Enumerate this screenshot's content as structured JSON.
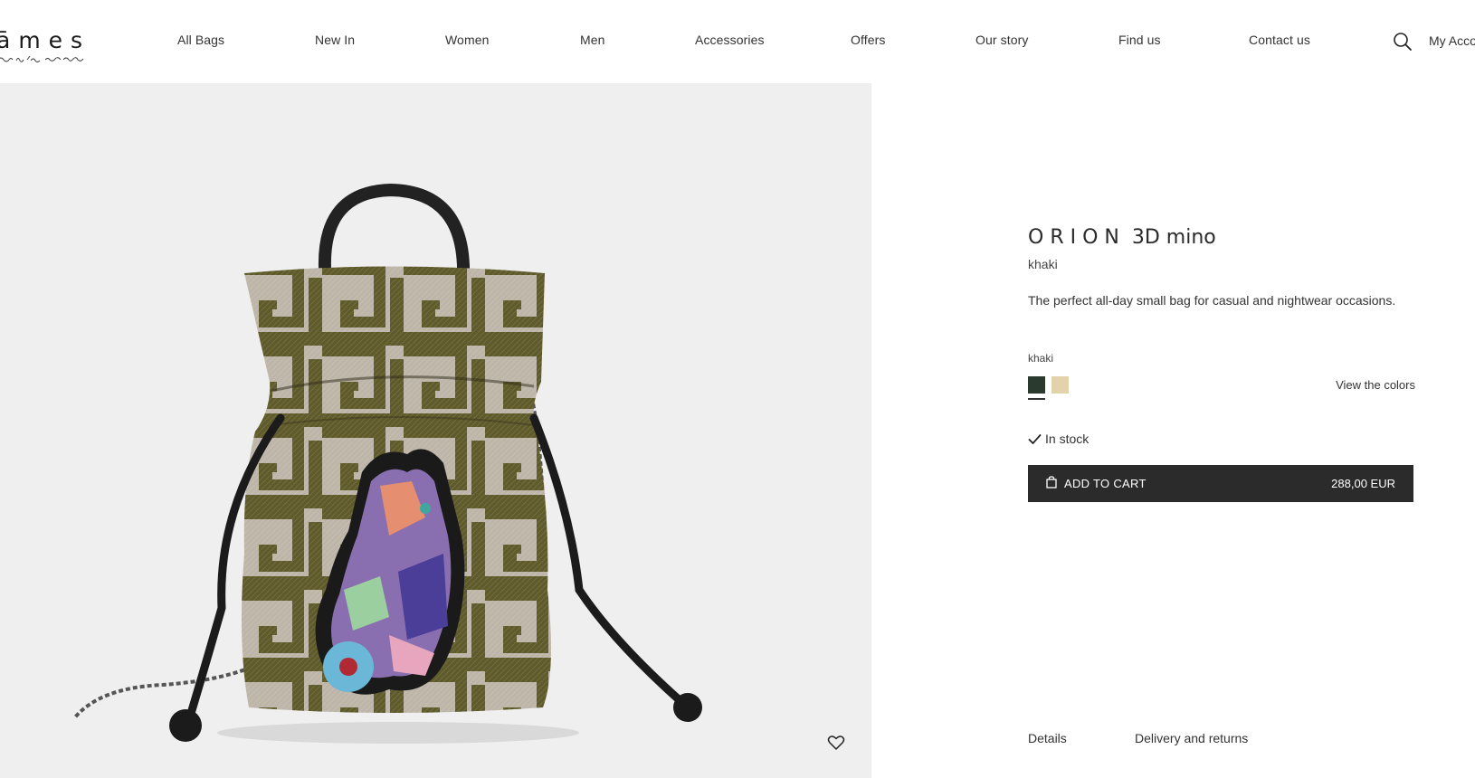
{
  "header": {
    "logo_text": "āmes",
    "nav": [
      "All Bags",
      "New In",
      "Women",
      "Men",
      "Accessories",
      "Offers",
      "Our story",
      "Find us",
      "Contact us"
    ],
    "search_icon": "search-icon",
    "account_label": "My Account"
  },
  "gallery": {
    "wishlist_icon": "heart-icon"
  },
  "product": {
    "brand": "ORION",
    "model": "3D mino",
    "color_name": "khaki",
    "description": "The perfect all-day small bag for casual and nightwear occasions.",
    "selected_color_label": "khaki",
    "swatches": [
      {
        "color": "#2a3a2c",
        "selected": true
      },
      {
        "color": "#e2d3ad",
        "selected": false
      }
    ],
    "view_colors_label": "View the colors",
    "stock_label": "In stock",
    "cart_label": "ADD TO CART",
    "price": "288,00 EUR"
  },
  "tabs": [
    "Details",
    "Delivery and returns"
  ],
  "colors": {
    "accent": "#2b2b2b",
    "background_gallery": "#efefef"
  }
}
